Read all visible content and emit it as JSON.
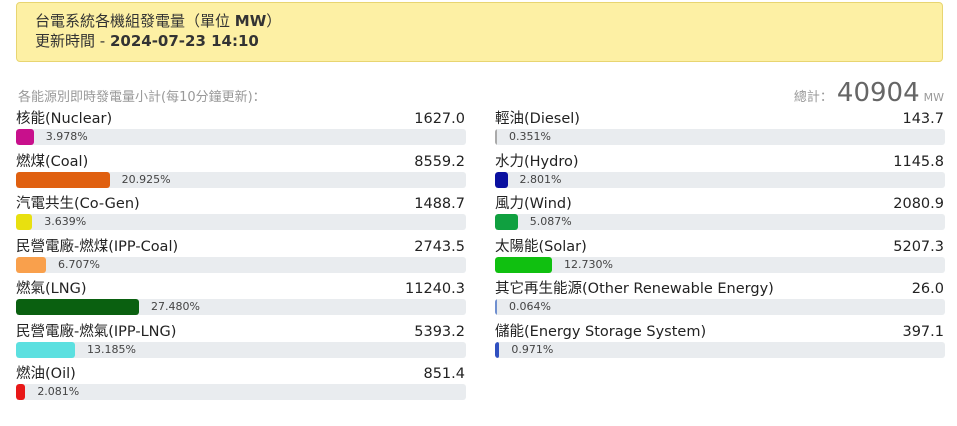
{
  "header": {
    "title_text": "台電系統各機組發電量（單位 ",
    "title_unit": "MW",
    "title_close": "）",
    "updated_label": "更新時間 - ",
    "updated_time": "2024-07-23 14:10"
  },
  "summary": {
    "subtitle": "各能源別即時發電量小計(每10分鐘更新)：",
    "total_label": "總計：",
    "total_value": "40904",
    "total_unit": "MW"
  },
  "left": [
    {
      "name": "核能(Nuclear)",
      "value": "1627.0",
      "percent_label": "3.978%",
      "percent": 3.978,
      "color": "#c8108c"
    },
    {
      "name": "燃煤(Coal)",
      "value": "8559.2",
      "percent_label": "20.925%",
      "percent": 20.925,
      "color": "#e06010"
    },
    {
      "name": "汽電共生(Co-Gen)",
      "value": "1488.7",
      "percent_label": "3.639%",
      "percent": 3.639,
      "color": "#e8e010"
    },
    {
      "name": "民營電廠-燃煤(IPP-Coal)",
      "value": "2743.5",
      "percent_label": "6.707%",
      "percent": 6.707,
      "color": "#f9a04c"
    },
    {
      "name": "燃氣(LNG)",
      "value": "11240.3",
      "percent_label": "27.480%",
      "percent": 27.48,
      "color": "#0a6010"
    },
    {
      "name": "民營電廠-燃氣(IPP-LNG)",
      "value": "5393.2",
      "percent_label": "13.185%",
      "percent": 13.185,
      "color": "#5ce0e0"
    },
    {
      "name": "燃油(Oil)",
      "value": "851.4",
      "percent_label": "2.081%",
      "percent": 2.081,
      "color": "#e81818"
    }
  ],
  "right": [
    {
      "name": "輕油(Diesel)",
      "value": "143.7",
      "percent_label": "0.351%",
      "percent": 0.351,
      "color": "#aaaaaa"
    },
    {
      "name": "水力(Hydro)",
      "value": "1145.8",
      "percent_label": "2.801%",
      "percent": 2.801,
      "color": "#0a10a0"
    },
    {
      "name": "風力(Wind)",
      "value": "2080.9",
      "percent_label": "5.087%",
      "percent": 5.087,
      "color": "#10a040"
    },
    {
      "name": "太陽能(Solar)",
      "value": "5207.3",
      "percent_label": "12.730%",
      "percent": 12.73,
      "color": "#10c010"
    },
    {
      "name": "其它再生能源(Other Renewable Energy)",
      "value": "26.0",
      "percent_label": "0.064%",
      "percent": 0.064,
      "color": "#7090d0"
    },
    {
      "name": "儲能(Energy Storage System)",
      "value": "397.1",
      "percent_label": "0.971%",
      "percent": 0.971,
      "color": "#3050c0"
    }
  ]
}
